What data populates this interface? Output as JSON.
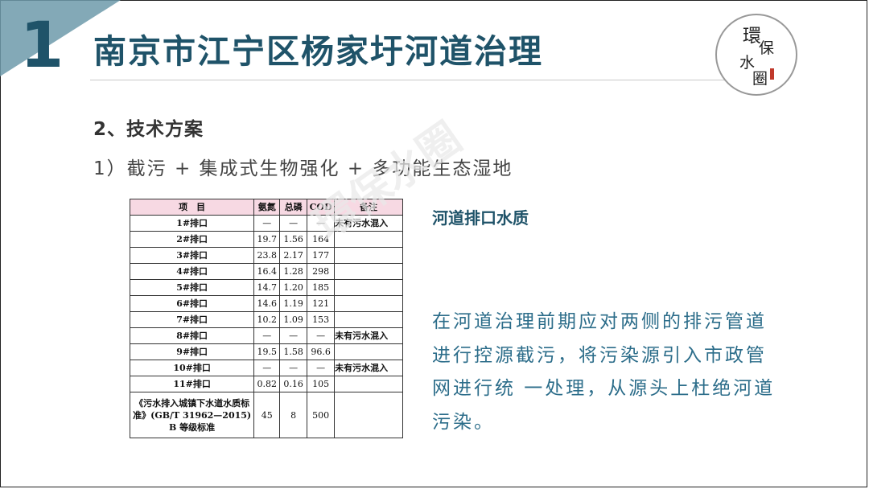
{
  "header": {
    "slide_number": "1",
    "title": "南京市江宁区杨家圩河道治理"
  },
  "logo": {
    "chars": [
      "環",
      "保",
      "水",
      "圈"
    ]
  },
  "section_heading": "2、技术方案",
  "subheading": "1）截污 + 集成式生物强化 + 多功能生态湿地",
  "table": {
    "headers": [
      "项　目",
      "氨氮",
      "总磷",
      "COD",
      "备注"
    ],
    "rows": [
      [
        "1#排口",
        "—",
        "—",
        "—",
        "未有污水混入"
      ],
      [
        "2#排口",
        "19.7",
        "1.56",
        "164",
        ""
      ],
      [
        "3#排口",
        "23.8",
        "2.17",
        "177",
        ""
      ],
      [
        "4#排口",
        "16.4",
        "1.28",
        "298",
        ""
      ],
      [
        "5#排口",
        "14.7",
        "1.20",
        "185",
        ""
      ],
      [
        "6#排口",
        "14.6",
        "1.19",
        "121",
        ""
      ],
      [
        "7#排口",
        "10.2",
        "1.09",
        "153",
        ""
      ],
      [
        "8#排口",
        "—",
        "—",
        "—",
        "未有污水混入"
      ],
      [
        "9#排口",
        "19.5",
        "1.58",
        "96.6",
        ""
      ],
      [
        "10#排口",
        "—",
        "—",
        "—",
        "未有污水混入"
      ],
      [
        "11#排口",
        "0.82",
        "0.16",
        "105",
        ""
      ]
    ],
    "standard_row": {
      "label": "《污水排入城镇下水道水质标准》(GB/T 31962—2015) B 等级标准",
      "values": [
        "45",
        "8",
        "500",
        ""
      ]
    }
  },
  "watermark": "環保水圈",
  "right_panel": {
    "title": "河道排口水质",
    "paragraph": "在河道治理前期应对两侧的排污管道进行控源截污，将污染源引入市政管网进行统 一处理，从源头上杜绝河道污染。"
  }
}
